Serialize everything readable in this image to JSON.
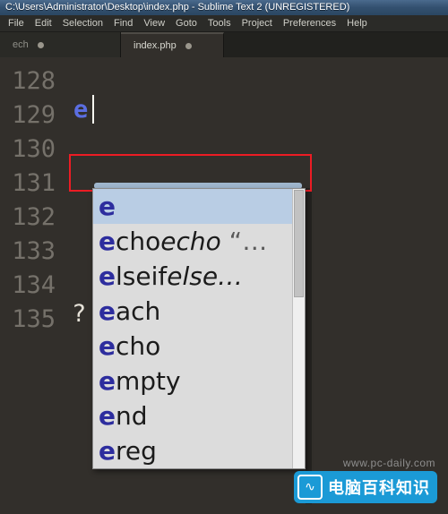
{
  "window": {
    "title": "C:\\Users\\Administrator\\Desktop\\index.php - Sublime Text 2 (UNREGISTERED)"
  },
  "menubar": {
    "items": [
      {
        "label": "File"
      },
      {
        "label": "Edit"
      },
      {
        "label": "Selection"
      },
      {
        "label": "Find"
      },
      {
        "label": "View"
      },
      {
        "label": "Goto"
      },
      {
        "label": "Tools"
      },
      {
        "label": "Project"
      },
      {
        "label": "Preferences"
      },
      {
        "label": "Help"
      }
    ]
  },
  "tabs": [
    {
      "label": "ech",
      "active": false,
      "modified": true
    },
    {
      "label": "index.php",
      "active": true,
      "modified": true
    }
  ],
  "editor": {
    "line_numbers": [
      "128",
      "129",
      "130",
      "131",
      "132",
      "133",
      "134",
      "135"
    ],
    "typed_text": "e",
    "php_close_tag": "?",
    "caret_visible": true
  },
  "autocomplete": {
    "items": [
      {
        "match": "e",
        "rest": "",
        "italic": "",
        "tail": "",
        "selected": true
      },
      {
        "match": "e",
        "rest": "cho",
        "italic": "echo",
        "tail": "  “…",
        "selected": false
      },
      {
        "match": "e",
        "rest": "lseif",
        "italic": "else…",
        "tail": "",
        "selected": false
      },
      {
        "match": "e",
        "rest": "ach",
        "italic": "",
        "tail": "",
        "selected": false
      },
      {
        "match": "e",
        "rest": "cho",
        "italic": "",
        "tail": "",
        "selected": false
      },
      {
        "match": "e",
        "rest": "mpty",
        "italic": "",
        "tail": "",
        "selected": false
      },
      {
        "match": "e",
        "rest": "nd",
        "italic": "",
        "tail": "",
        "selected": false
      },
      {
        "match": "e",
        "rest": "reg",
        "italic": "",
        "tail": "",
        "selected": false
      }
    ]
  },
  "watermark": {
    "url": "www.pc-daily.com",
    "brand": "电脑百科知识",
    "icon": "monitor-icon"
  },
  "colors": {
    "titlebar": "#33506f",
    "editor_bg": "#322f2b",
    "gutter_text": "#75716a",
    "highlight_box": "#ec1c24",
    "selected_row": "#b9cde4",
    "match_char": "#2d2d9e",
    "brand": "#1b9ad6"
  }
}
